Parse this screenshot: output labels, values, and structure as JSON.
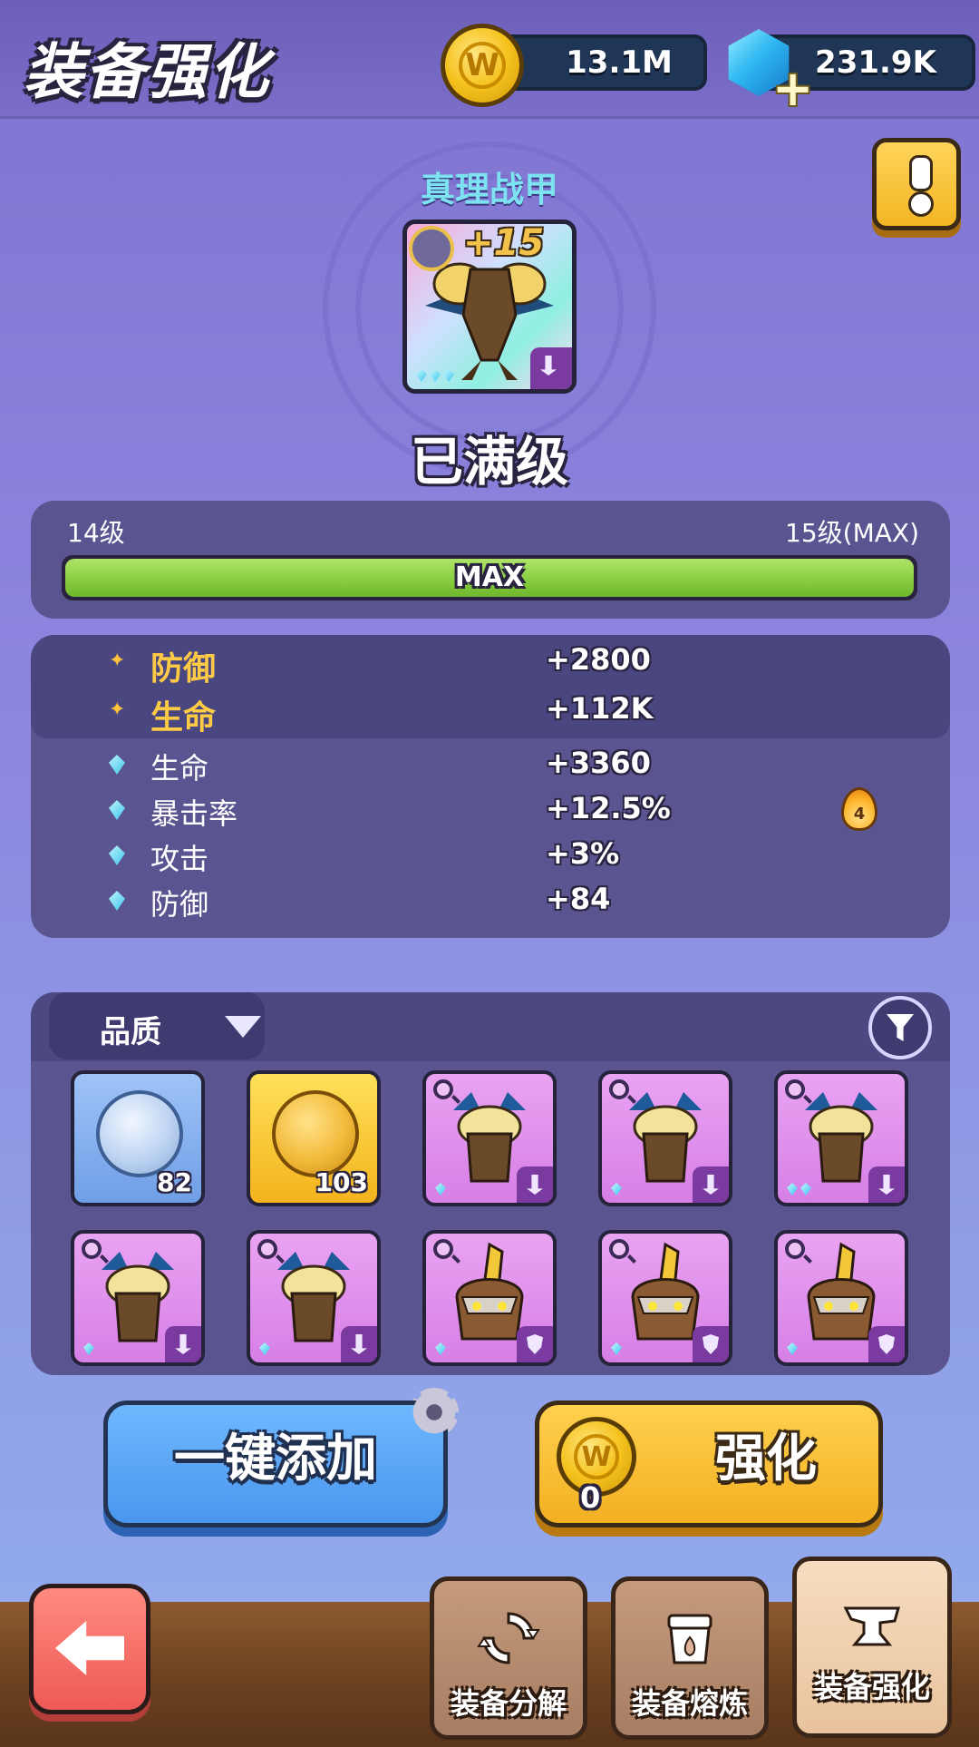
{
  "header": {
    "title": "装备强化",
    "gold": "13.1M",
    "gems": "231.9K",
    "gem_plus": "+"
  },
  "equipment": {
    "name": "真理战甲",
    "enhance_level": "+15",
    "status": "已满级"
  },
  "level_bar": {
    "current_label": "14级",
    "next_label": "15级(MAX)",
    "bar_text": "MAX",
    "progress": 1.0
  },
  "stats": {
    "main": [
      {
        "name": "防御",
        "value": "+2800"
      },
      {
        "name": "生命",
        "value": "+112K"
      }
    ],
    "sub": [
      {
        "name": "生命",
        "value": "+3360"
      },
      {
        "name": "暴击率",
        "value": "+12.5%"
      },
      {
        "name": "攻击",
        "value": "+3%"
      },
      {
        "name": "防御",
        "value": "+84"
      }
    ],
    "flame_count": "4"
  },
  "inventory": {
    "sort_label": "品质",
    "items": [
      {
        "kind": "silver-coin",
        "count": "82"
      },
      {
        "kind": "gold-coin",
        "count": "103"
      },
      {
        "kind": "armor"
      },
      {
        "kind": "armor"
      },
      {
        "kind": "armor"
      },
      {
        "kind": "armor"
      },
      {
        "kind": "armor"
      },
      {
        "kind": "helmet"
      },
      {
        "kind": "helmet"
      },
      {
        "kind": "helmet"
      }
    ]
  },
  "actions": {
    "add_all": "一键添加",
    "upgrade": "强化",
    "cost": "0"
  },
  "nav": {
    "tabs": [
      {
        "label": "装备分解"
      },
      {
        "label": "装备熔炼"
      },
      {
        "label": "装备强化"
      }
    ]
  },
  "colors": {
    "background": "#8a84dc",
    "accent_gold": "#ffcb44",
    "bar_green": "#86cc3c",
    "button_blue": "#4a96ee",
    "button_yellow": "#f3b022"
  }
}
